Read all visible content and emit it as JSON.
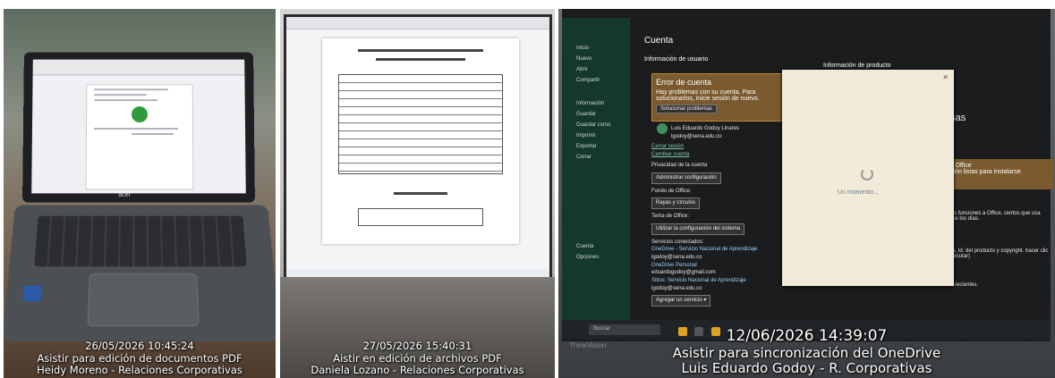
{
  "panels": [
    {
      "timestamp": "26/05/2026 10:45:24",
      "caption_line1": "Asistir para edición de documentos PDF",
      "caption_line2": "Heidy Moreno - Relaciones Corporativas",
      "laptop_brand": "acer"
    },
    {
      "timestamp": "27/05/2026 15:40:31",
      "caption_line1": "Aistir en edición de archivos PDF",
      "caption_line2": "Daniela Lozano - Relaciones Corporativas"
    },
    {
      "timestamp": "12/06/2026 14:39:07",
      "caption_line1": "Asistir para sincronización del OneDrive",
      "caption_line2": "Luis Eduardo Godoy - R. Corporativas",
      "screen": {
        "sidebar": [
          "Inicio",
          "Nuevo",
          "Abrir",
          "Compartir",
          "Información",
          "Guardar",
          "Guardar como",
          "Imprimir",
          "Exportar",
          "Cerrar",
          "Cuenta",
          "Opciones"
        ],
        "page_title": "Cuenta",
        "user_info_heading": "Información de usuario",
        "product_info_heading": "Información de producto",
        "error_title": "Error de cuenta",
        "error_text": "Hay problemas con su cuenta. Para solucionarlos, inicie sesión de nuevo.",
        "error_button": "Solucionar problemas",
        "user_name": "Luis Eduardo Godoy Linares",
        "user_email": "lgodoy@sena.edu.co",
        "link_cerrar_sesion": "Cerrar sesión",
        "link_cambiar_cuenta": "Cambiar cuenta",
        "privacy_heading": "Privacidad de la cuenta",
        "privacy_button": "Administrar configuración",
        "background_heading": "Fondo de Office:",
        "background_value": "Rayas y círculos",
        "theme_heading": "Tema de Office:",
        "theme_value": "Utilizar la configuración del sistema",
        "services_heading": "Servicios conectados:",
        "services": [
          {
            "name": "OneDrive - Servicio Nacional de Aprendizaje",
            "email": "lgodoy@sena.edu.co"
          },
          {
            "name": "OneDrive Personal",
            "email": "eduardogodoy@gmail.com"
          },
          {
            "name": "Sitios: Servicio Nacional de Aprendizaje",
            "email": "lgodoy@sena.edu.co"
          }
        ],
        "add_service_button": "Agregar un servicio ▾",
        "right_fragment_1": "esas",
        "right_fragment_2": "y Office",
        "right_fragment_3": "sión listas para instalarse.",
        "right_fragment_4": "unas funciones a Office, ciertos que usa todos los días.",
        "right_fragment_5": "cuta, Id. del producto y copyright. hacer clic y ejecutar)",
        "right_fragment_6": "Mire las actualizaciones instaladas más recientes.",
        "modal_loading": "Un momento...",
        "taskbar_search": "Buscar",
        "monitor_brand": "ThinkVision"
      }
    }
  ],
  "colors": {
    "caption_text": "#ffffff",
    "office_sidebar": "#14392a",
    "error_box": "#7a5a2e",
    "modal_bg": "#f2ead8"
  }
}
